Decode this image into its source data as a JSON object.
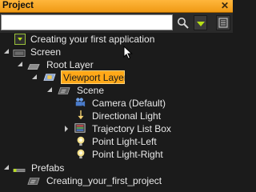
{
  "window": {
    "title": "Project"
  },
  "search": {
    "value": "",
    "placeholder": ""
  },
  "colors": {
    "accent": "#ffa818",
    "filter": "#b7e016"
  },
  "tree": {
    "hint": "Creating your first application",
    "screen": "Screen",
    "root_layer": "Root Layer",
    "viewport_layer": "Viewport Layer",
    "scene": "Scene",
    "camera": "Camera (Default)",
    "directional_light": "Directional Light",
    "trajectory_list_box": "Trajectory List Box",
    "point_light_left": "Point Light-Left",
    "point_light_right": "Point Light-Right",
    "prefabs": "Prefabs",
    "project_prefab": "Creating_your_first_project"
  }
}
